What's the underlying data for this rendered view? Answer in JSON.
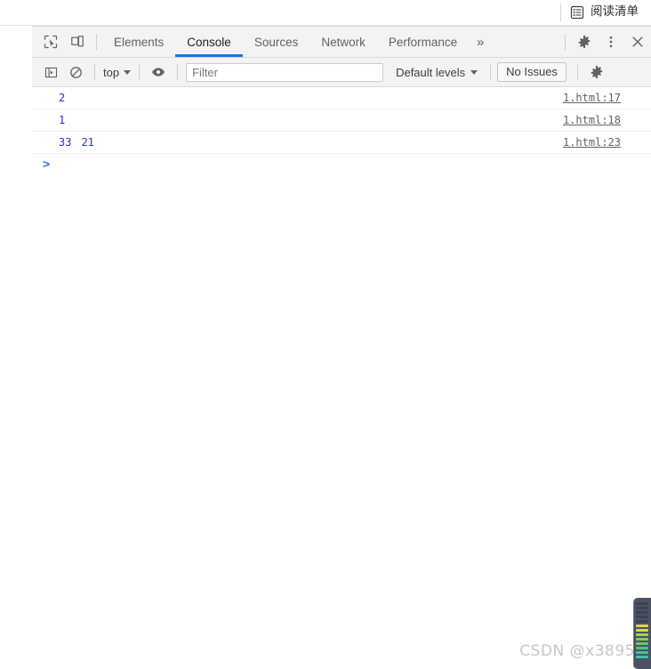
{
  "browser": {
    "reading_list_label": "阅读清单",
    "reading_list_icon": "reading-list-icon"
  },
  "devtools": {
    "tabbar": {
      "inspect_icon": "inspect-element-icon",
      "device_icon": "device-toolbar-icon",
      "tabs": [
        {
          "label": "Elements",
          "active": false
        },
        {
          "label": "Console",
          "active": true
        },
        {
          "label": "Sources",
          "active": false
        },
        {
          "label": "Network",
          "active": false
        },
        {
          "label": "Performance",
          "active": false
        }
      ],
      "overflow_label": "»",
      "settings_icon": "gear-icon",
      "menu_icon": "kebab-menu-icon",
      "close_icon": "close-icon"
    },
    "console_toolbar": {
      "sidebar_icon": "console-sidebar-icon",
      "clear_icon": "clear-console-icon",
      "context": "top",
      "eye_icon": "live-expression-eye-icon",
      "filter_placeholder": "Filter",
      "filter_value": "",
      "levels_label": "Default levels",
      "issues_label": "No Issues",
      "settings_icon": "gear-icon"
    },
    "console_rows": [
      {
        "values": [
          "2"
        ],
        "source": "1.html:17"
      },
      {
        "values": [
          "1"
        ],
        "source": "1.html:18"
      },
      {
        "values": [
          "33",
          "21"
        ],
        "source": "1.html:23"
      }
    ],
    "prompt_caret": ">"
  },
  "watermark": "CSDN @x3895",
  "level_meter": {
    "segments": [
      "#3c4250",
      "#3c4250",
      "#3c4250",
      "#3c4250",
      "#3c4250",
      "#d8d84a",
      "#d8d84a",
      "#9ed94e",
      "#7fd34e",
      "#62cd5a",
      "#4ec77a",
      "#46c39a",
      "#44bfb0"
    ]
  },
  "colors": {
    "accent": "#1a73e8",
    "toolbar_bg": "#f3f3f3",
    "log_number": "#2a30c4",
    "link": "#5f6368"
  }
}
